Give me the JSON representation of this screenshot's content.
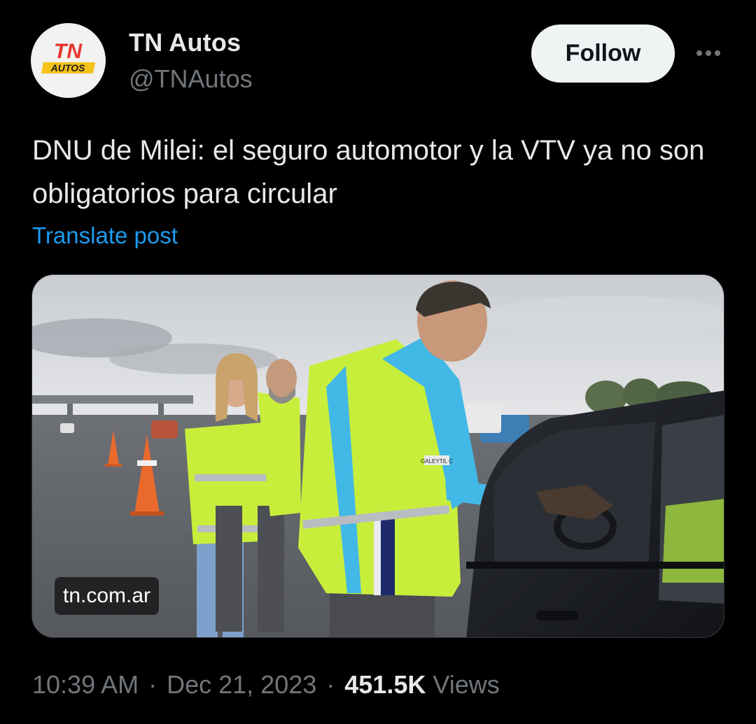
{
  "author": {
    "name": "TN Autos",
    "handle": "@TNAutos",
    "avatar_logo_top": "TN",
    "avatar_logo_bottom": "AUTOS"
  },
  "actions": {
    "follow_label": "Follow"
  },
  "post": {
    "text": "DNU de Milei: el seguro automotor y la VTV ya no son obligatorios para circular",
    "translate_label": "Translate post"
  },
  "media": {
    "source_label": "tn.com.ar",
    "vest_badge_text": "GALEYTIL C"
  },
  "footer": {
    "time": "10:39 AM",
    "separator": "·",
    "date": "Dec 21, 2023",
    "views_count": "451.5K",
    "views_label": "Views"
  },
  "colors": {
    "background": "#000000",
    "primary_text": "#e7e9ea",
    "secondary_text": "#71767b",
    "link": "#1d9bf0",
    "follow_bg": "#eff3f4",
    "brand_red": "#e8352b",
    "brand_yellow": "#f5c21b"
  }
}
